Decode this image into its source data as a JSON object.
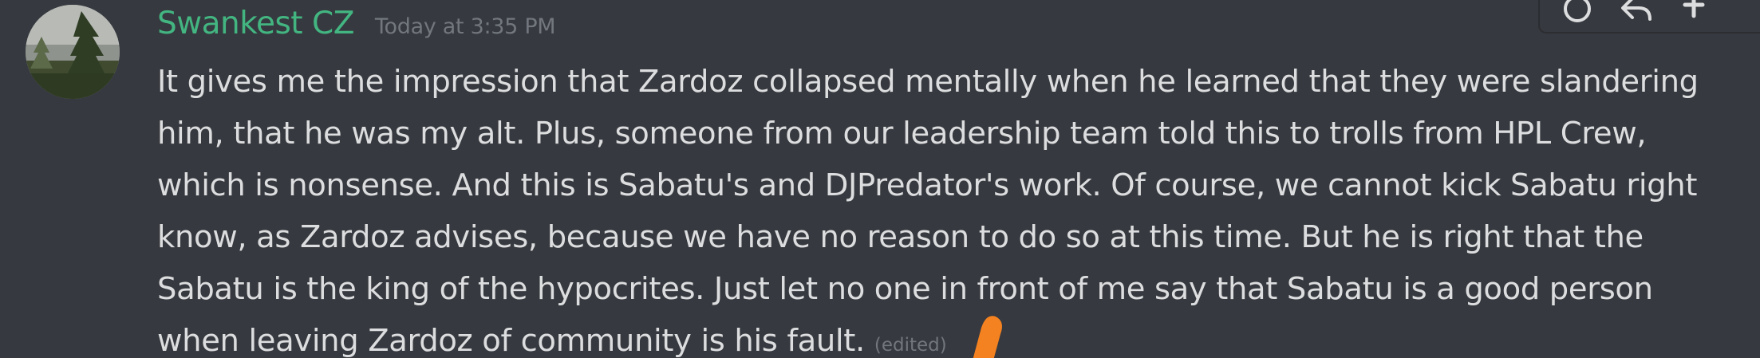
{
  "message": {
    "author": "Swankest CZ",
    "timestamp": "Today at 3:35 PM",
    "lines": [
      "It gives me the impression that Zardoz collapsed mentally when he learned that they were slandering",
      "him, that he was my alt. Plus, someone from our leadership team told this to trolls from HPL Crew,",
      "which is nonsense. And this is Sabatu's and DJPredator's work. Of course, we cannot kick Sabatu right",
      "know, as Zardoz advises, because we have no reason to do so at this time. But he is right that the",
      "Sabatu is the king of the hypocrites. Just let no one in front of me say that Sabatu is a good person",
      "when leaving Zardoz of community is his fault."
    ],
    "edited_label": "(edited)"
  },
  "toolbar": {
    "icons": [
      "add-reaction-icon",
      "reply-icon",
      "more-icon"
    ]
  },
  "colors": {
    "background": "#36393f",
    "username": "#43b581",
    "text": "#dcddde",
    "muted": "#72767d",
    "touch_marker": "#f58220"
  }
}
